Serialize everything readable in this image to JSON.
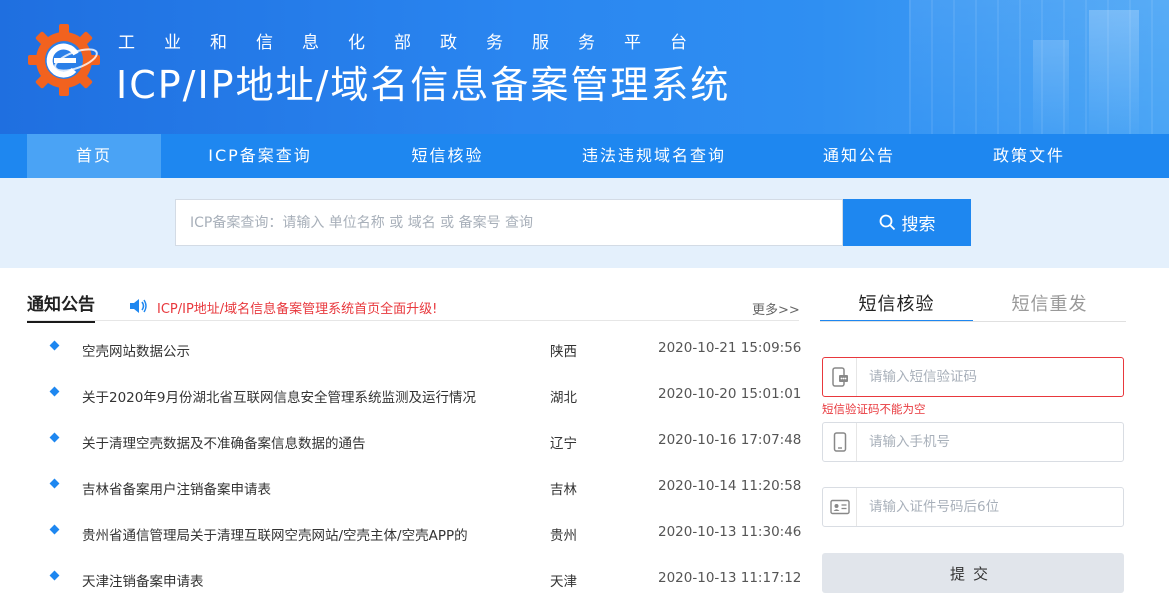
{
  "header": {
    "subtitle": "工业和信息化部政务服务平台",
    "title": "ICP/IP地址/域名信息备案管理系统",
    "logo_icon": "gear-logo-icon"
  },
  "nav": {
    "items": [
      {
        "label": "首页",
        "active": true
      },
      {
        "label": "ICP备案查询",
        "active": false
      },
      {
        "label": "短信核验",
        "active": false
      },
      {
        "label": "违法违规域名查询",
        "active": false
      },
      {
        "label": "通知公告",
        "active": false
      },
      {
        "label": "政策文件",
        "active": false
      }
    ]
  },
  "search": {
    "placeholder": "ICP备案查询：请输入 单位名称 或 域名 或 备案号 查询",
    "value": "",
    "button_label": "搜索",
    "button_icon": "search-icon"
  },
  "notices": {
    "title": "通知公告",
    "marquee_icon": "speaker-icon",
    "marquee": "ICP/IP地址/域名信息备案管理系统首页全面升级!",
    "more_label": "更多>>",
    "items": [
      {
        "title": "空壳网站数据公示",
        "province": "陕西",
        "date": "2020-10-21 15:09:56"
      },
      {
        "title": "关于2020年9月份湖北省互联网信息安全管理系统监测及运行情况",
        "province": "湖北",
        "date": "2020-10-20 15:01:01"
      },
      {
        "title": "关于清理空壳数据及不准确备案信息数据的通告",
        "province": "辽宁",
        "date": "2020-10-16 17:07:48"
      },
      {
        "title": "吉林省备案用户注销备案申请表",
        "province": "吉林",
        "date": "2020-10-14 11:20:58"
      },
      {
        "title": "贵州省通信管理局关于清理互联网空壳网站/空壳主体/空壳APP的",
        "province": "贵州",
        "date": "2020-10-13 11:30:46"
      },
      {
        "title": "天津注销备案申请表",
        "province": "天津",
        "date": "2020-10-13 11:17:12"
      }
    ]
  },
  "sms": {
    "tab_verify": "短信核验",
    "tab_resend": "短信重发",
    "code_placeholder": "请输入短信验证码",
    "code_error": "短信验证码不能为空",
    "phone_placeholder": "请输入手机号",
    "id_placeholder": "请输入证件号码后6位",
    "submit_label": "提交",
    "icons": [
      "sms-code-icon",
      "mobile-phone-icon",
      "id-card-icon"
    ]
  },
  "colors": {
    "primary": "#1e87f0",
    "nav_active": "#4aa3f5",
    "error": "#e8383d",
    "search_band": "#e4f0fc"
  }
}
